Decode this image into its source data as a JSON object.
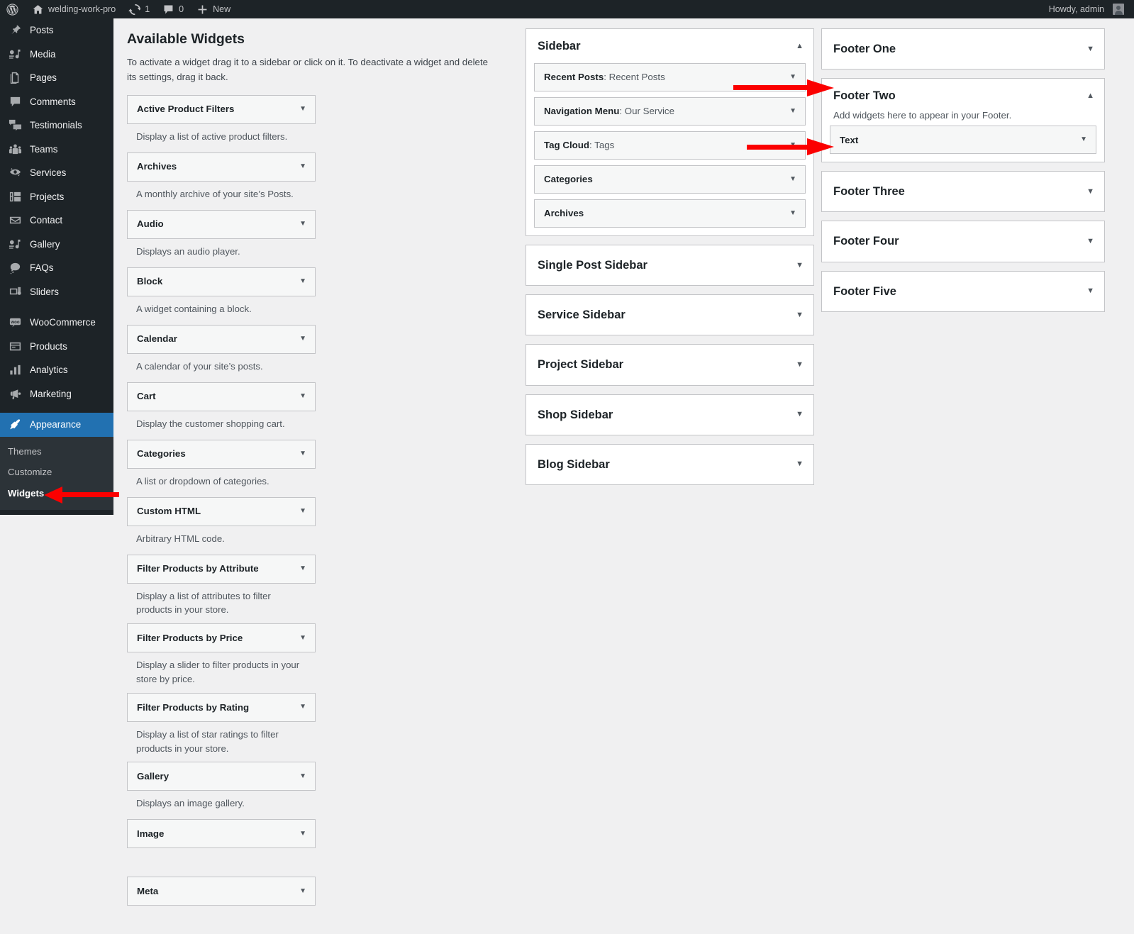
{
  "adminbar": {
    "site_name": "welding-work-pro",
    "updates_count": "1",
    "comments_count": "0",
    "new_label": "New",
    "greeting": "Howdy, admin",
    "icons": {
      "wp_logo": "wordpress-logo-icon",
      "home": "home-icon",
      "updates": "updates-icon",
      "comments": "comment-icon",
      "new": "plus-icon",
      "avatar": "avatar"
    }
  },
  "adminmenu": {
    "items": [
      {
        "label": "Posts",
        "icon": "pin-icon"
      },
      {
        "label": "Media",
        "icon": "media-icon"
      },
      {
        "label": "Pages",
        "icon": "pages-icon"
      },
      {
        "label": "Comments",
        "icon": "comment-icon"
      },
      {
        "label": "Testimonials",
        "icon": "testimonials-icon"
      },
      {
        "label": "Teams",
        "icon": "teams-icon"
      },
      {
        "label": "Services",
        "icon": "services-icon"
      },
      {
        "label": "Projects",
        "icon": "projects-icon"
      },
      {
        "label": "Contact",
        "icon": "envelope-icon"
      },
      {
        "label": "Gallery",
        "icon": "gallery-icon"
      },
      {
        "label": "FAQs",
        "icon": "faqs-icon"
      },
      {
        "label": "Sliders",
        "icon": "sliders-icon"
      },
      {
        "label": "",
        "icon": "separator"
      },
      {
        "label": "WooCommerce",
        "icon": "woocommerce-icon"
      },
      {
        "label": "Products",
        "icon": "products-icon"
      },
      {
        "label": "Analytics",
        "icon": "analytics-icon"
      },
      {
        "label": "Marketing",
        "icon": "marketing-icon"
      },
      {
        "label": "",
        "icon": "separator"
      },
      {
        "label": "Appearance",
        "icon": "appearance-icon",
        "current": true
      }
    ],
    "submenu": [
      {
        "label": "Themes"
      },
      {
        "label": "Customize"
      },
      {
        "label": "Widgets",
        "current": true
      }
    ]
  },
  "available_widgets": {
    "title": "Available Widgets",
    "description": "To activate a widget drag it to a sidebar or click on it. To deactivate a widget and delete its settings, drag it back.",
    "widgets": [
      {
        "name": "Active Product Filters",
        "desc": "Display a list of active product filters."
      },
      {
        "name": "Archives",
        "desc": "A monthly archive of your site’s Posts."
      },
      {
        "name": "Audio",
        "desc": "Displays an audio player."
      },
      {
        "name": "Block",
        "desc": "A widget containing a block."
      },
      {
        "name": "Calendar",
        "desc": "A calendar of your site’s posts."
      },
      {
        "name": "Cart",
        "desc": "Display the customer shopping cart."
      },
      {
        "name": "Categories",
        "desc": "A list or dropdown of categories."
      },
      {
        "name": "Custom HTML",
        "desc": "Arbitrary HTML code."
      },
      {
        "name": "Filter Products by Attribute",
        "desc": "Display a list of attributes to filter products in your store."
      },
      {
        "name": "Filter Products by Price",
        "desc": "Display a slider to filter products in your store by price."
      },
      {
        "name": "Filter Products by Rating",
        "desc": "Display a list of star ratings to filter products in your store."
      },
      {
        "name": "Gallery",
        "desc": "Displays an image gallery."
      },
      {
        "name": "Image",
        "desc": ""
      },
      {
        "name": "Meta",
        "desc": ""
      }
    ]
  },
  "sidebars_column": [
    {
      "name": "Sidebar",
      "expanded": true,
      "toggle_glyph": "▲",
      "widgets": [
        {
          "type": "Recent Posts",
          "instance": "Recent Posts"
        },
        {
          "type": "Navigation Menu",
          "instance": "Our Service"
        },
        {
          "type": "Tag Cloud",
          "instance": "Tags"
        },
        {
          "type": "Categories",
          "instance": ""
        },
        {
          "type": "Archives",
          "instance": ""
        }
      ]
    },
    {
      "name": "Single Post Sidebar",
      "expanded": false,
      "toggle_glyph": "▼",
      "widgets": []
    },
    {
      "name": "Service Sidebar",
      "expanded": false,
      "toggle_glyph": "▼",
      "widgets": []
    },
    {
      "name": "Project Sidebar",
      "expanded": false,
      "toggle_glyph": "▼",
      "widgets": []
    },
    {
      "name": "Shop Sidebar",
      "expanded": false,
      "toggle_glyph": "▼",
      "widgets": []
    },
    {
      "name": "Blog Sidebar",
      "expanded": false,
      "toggle_glyph": "▼",
      "widgets": []
    }
  ],
  "footers_column": [
    {
      "name": "Footer One",
      "expanded": false,
      "toggle_glyph": "▼",
      "description": "",
      "widgets": []
    },
    {
      "name": "Footer Two",
      "expanded": true,
      "toggle_glyph": "▲",
      "description": "Add widgets here to appear in your Footer.",
      "widgets": [
        {
          "type": "Text",
          "instance": ""
        }
      ]
    },
    {
      "name": "Footer Three",
      "expanded": false,
      "toggle_glyph": "▼",
      "description": "",
      "widgets": []
    },
    {
      "name": "Footer Four",
      "expanded": false,
      "toggle_glyph": "▼",
      "description": "",
      "widgets": []
    },
    {
      "name": "Footer Five",
      "expanded": false,
      "toggle_glyph": "▼",
      "description": "",
      "widgets": []
    }
  ],
  "annotations": {
    "arrow_color": "#fb0000",
    "arrows": [
      {
        "name": "arrow-to-widgets-menu",
        "direction": "left"
      },
      {
        "name": "arrow-to-footer-two",
        "direction": "right"
      },
      {
        "name": "arrow-to-text-widget",
        "direction": "right"
      }
    ]
  },
  "colors": {
    "admin_bar": "#1d2327",
    "menu_bg": "#1d2327",
    "submenu_bg": "#2c3338",
    "current_menu": "#2271b1",
    "page_bg": "#f0f0f1",
    "panel_bg": "#ffffff",
    "widget_bg": "#f6f7f7",
    "border": "#c3c4c7"
  }
}
